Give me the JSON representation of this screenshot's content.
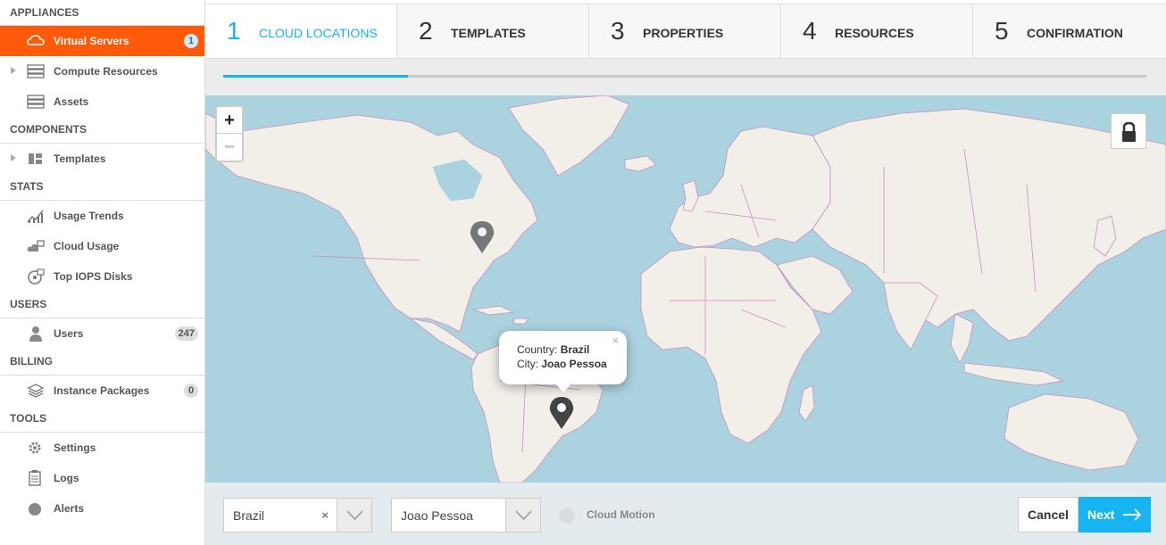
{
  "sidebar": {
    "sections": [
      {
        "title": "APPLIANCES",
        "items": [
          {
            "label": "Virtual Servers",
            "icon": "cloud-icon",
            "badge": "1",
            "active": true
          },
          {
            "label": "Compute Resources",
            "icon": "server-icon",
            "expandable": true
          },
          {
            "label": "Assets",
            "icon": "server-icon"
          }
        ]
      },
      {
        "title": "COMPONENTS",
        "items": [
          {
            "label": "Templates",
            "icon": "templates-icon",
            "expandable": true
          }
        ]
      },
      {
        "title": "STATS",
        "items": [
          {
            "label": "Usage Trends",
            "icon": "chart-icon"
          },
          {
            "label": "Cloud Usage",
            "icon": "cloud-usage-icon"
          },
          {
            "label": "Top IOPS Disks",
            "icon": "disk-icon"
          }
        ]
      },
      {
        "title": "USERS",
        "items": [
          {
            "label": "Users",
            "icon": "user-icon",
            "badge": "247"
          }
        ]
      },
      {
        "title": "BILLING",
        "items": [
          {
            "label": "Instance Packages",
            "icon": "packages-icon",
            "badge": "0"
          }
        ]
      },
      {
        "title": "TOOLS",
        "items": [
          {
            "label": "Settings",
            "icon": "gear-icon"
          },
          {
            "label": "Logs",
            "icon": "clipboard-icon"
          },
          {
            "label": "Alerts",
            "icon": "alert-icon"
          }
        ]
      }
    ]
  },
  "wizard": {
    "steps": [
      {
        "number": "1",
        "label": "CLOUD LOCATIONS",
        "active": true
      },
      {
        "number": "2",
        "label": "TEMPLATES"
      },
      {
        "number": "3",
        "label": "PROPERTIES"
      },
      {
        "number": "4",
        "label": "RESOURCES"
      },
      {
        "number": "5",
        "label": "CONFIRMATION"
      }
    ],
    "progress_fraction": 0.2
  },
  "map": {
    "zoom_in": "+",
    "zoom_out": "−",
    "popup": {
      "country_label": "Country:",
      "country": "Brazil",
      "city_label": "City:",
      "city": "Joao Pessoa",
      "close": "×"
    },
    "colors": {
      "water": "#aad3df",
      "land": "#f2efe9",
      "border": "#c88fc0",
      "pin_inactive": "#777777",
      "pin_active": "#444444"
    }
  },
  "footer": {
    "country_select": {
      "value": "Brazil",
      "clear": "×"
    },
    "city_select": {
      "value": "Joao Pessoa"
    },
    "cloud_motion_label": "Cloud Motion",
    "cancel_label": "Cancel",
    "next_label": "Next"
  },
  "colors": {
    "accent": "#16b4e8",
    "active_item": "#ff5a0a"
  }
}
